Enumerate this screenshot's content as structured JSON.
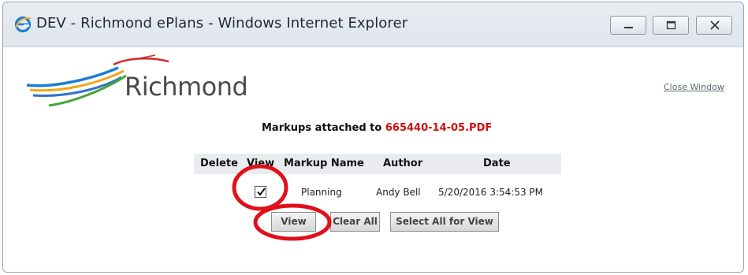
{
  "window": {
    "title": "DEV - Richmond ePlans - Windows Internet Explorer",
    "icon": "internet-explorer-icon",
    "controls": [
      "minimize-icon",
      "maximize-icon",
      "close-icon"
    ]
  },
  "header": {
    "brand": "Richmond",
    "close_link": "Close Window"
  },
  "markups": {
    "heading_prefix": "Markups attached to",
    "filename": "665440-14-05.PDF",
    "filename_color": "#d01010"
  },
  "table": {
    "columns": [
      "Delete",
      "View",
      "Markup Name",
      "Author",
      "Date"
    ],
    "rows": [
      {
        "view_checked": true,
        "markup_name": "Planning",
        "author": "Andy Bell",
        "date": "5/20/2016 3:54:53 PM"
      }
    ]
  },
  "buttons": {
    "view": "View",
    "clear_all": "Clear All",
    "select_all": "Select All for View"
  },
  "annotation_color": "#e0101a"
}
